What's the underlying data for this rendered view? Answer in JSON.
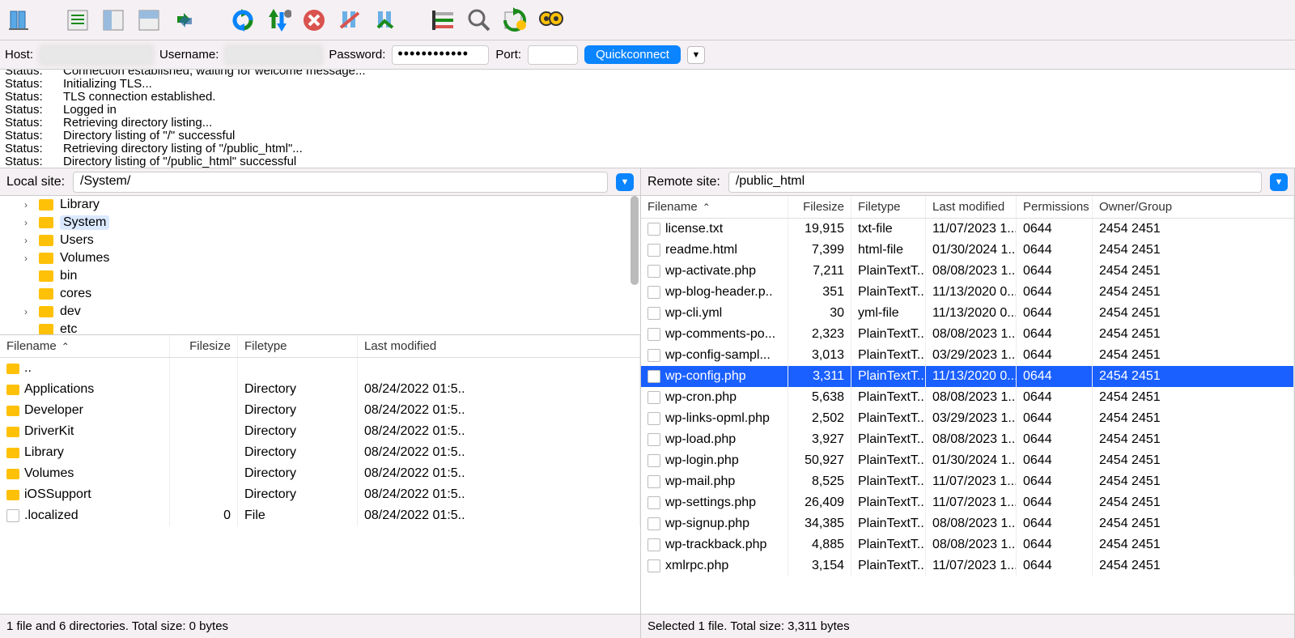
{
  "quickbar": {
    "host_label": "Host:",
    "username_label": "Username:",
    "password_label": "Password:",
    "password_dots": "••••••••••••",
    "port_label": "Port:",
    "quickconnect": "Quickconnect"
  },
  "log": [
    {
      "label": "Status:",
      "msg": "Connection established, waiting for welcome message..."
    },
    {
      "label": "Status:",
      "msg": "Initializing TLS..."
    },
    {
      "label": "Status:",
      "msg": "TLS connection established."
    },
    {
      "label": "Status:",
      "msg": "Logged in"
    },
    {
      "label": "Status:",
      "msg": "Retrieving directory listing..."
    },
    {
      "label": "Status:",
      "msg": "Directory listing of \"/\" successful"
    },
    {
      "label": "Status:",
      "msg": "Retrieving directory listing of \"/public_html\"..."
    },
    {
      "label": "Status:",
      "msg": "Directory listing of \"/public_html\" successful"
    }
  ],
  "local": {
    "site_label": "Local site:",
    "path": "/System/",
    "tree": [
      {
        "name": "Library",
        "expandable": true,
        "selected": false
      },
      {
        "name": "System",
        "expandable": true,
        "selected": true
      },
      {
        "name": "Users",
        "expandable": true,
        "selected": false
      },
      {
        "name": "Volumes",
        "expandable": true,
        "selected": false
      },
      {
        "name": "bin",
        "expandable": false,
        "selected": false
      },
      {
        "name": "cores",
        "expandable": false,
        "selected": false
      },
      {
        "name": "dev",
        "expandable": true,
        "selected": false
      },
      {
        "name": "etc",
        "expandable": false,
        "selected": false
      }
    ],
    "headers": {
      "name": "Filename",
      "size": "Filesize",
      "type": "Filetype",
      "mod": "Last modified"
    },
    "files": [
      {
        "name": "..",
        "size": "",
        "type": "",
        "mod": "",
        "icon": "folder"
      },
      {
        "name": "Applications",
        "size": "",
        "type": "Directory",
        "mod": "08/24/2022 01:5..",
        "icon": "folder"
      },
      {
        "name": "Developer",
        "size": "",
        "type": "Directory",
        "mod": "08/24/2022 01:5..",
        "icon": "folder"
      },
      {
        "name": "DriverKit",
        "size": "",
        "type": "Directory",
        "mod": "08/24/2022 01:5..",
        "icon": "folder"
      },
      {
        "name": "Library",
        "size": "",
        "type": "Directory",
        "mod": "08/24/2022 01:5..",
        "icon": "folder"
      },
      {
        "name": "Volumes",
        "size": "",
        "type": "Directory",
        "mod": "08/24/2022 01:5..",
        "icon": "folder"
      },
      {
        "name": "iOSSupport",
        "size": "",
        "type": "Directory",
        "mod": "08/24/2022 01:5..",
        "icon": "folder"
      },
      {
        "name": ".localized",
        "size": "0",
        "type": "File",
        "mod": "08/24/2022 01:5..",
        "icon": "file"
      }
    ],
    "status": "1 file and 6 directories. Total size: 0 bytes"
  },
  "remote": {
    "site_label": "Remote site:",
    "path": "/public_html",
    "headers": {
      "name": "Filename",
      "size": "Filesize",
      "type": "Filetype",
      "mod": "Last modified",
      "perm": "Permissions",
      "owner": "Owner/Group"
    },
    "files": [
      {
        "name": "license.txt",
        "size": "19,915",
        "type": "txt-file",
        "mod": "11/07/2023 1...",
        "perm": "0644",
        "owner": "2454 2451",
        "selected": false
      },
      {
        "name": "readme.html",
        "size": "7,399",
        "type": "html-file",
        "mod": "01/30/2024 1...",
        "perm": "0644",
        "owner": "2454 2451",
        "selected": false
      },
      {
        "name": "wp-activate.php",
        "size": "7,211",
        "type": "PlainTextT...",
        "mod": "08/08/2023 1...",
        "perm": "0644",
        "owner": "2454 2451",
        "selected": false
      },
      {
        "name": "wp-blog-header.p..",
        "size": "351",
        "type": "PlainTextT...",
        "mod": "11/13/2020 0...",
        "perm": "0644",
        "owner": "2454 2451",
        "selected": false
      },
      {
        "name": "wp-cli.yml",
        "size": "30",
        "type": "yml-file",
        "mod": "11/13/2020 0...",
        "perm": "0644",
        "owner": "2454 2451",
        "selected": false
      },
      {
        "name": "wp-comments-po...",
        "size": "2,323",
        "type": "PlainTextT...",
        "mod": "08/08/2023 1...",
        "perm": "0644",
        "owner": "2454 2451",
        "selected": false
      },
      {
        "name": "wp-config-sampl...",
        "size": "3,013",
        "type": "PlainTextT...",
        "mod": "03/29/2023 1...",
        "perm": "0644",
        "owner": "2454 2451",
        "selected": false
      },
      {
        "name": "wp-config.php",
        "size": "3,311",
        "type": "PlainTextT...",
        "mod": "11/13/2020 0...",
        "perm": "0644",
        "owner": "2454 2451",
        "selected": true
      },
      {
        "name": "wp-cron.php",
        "size": "5,638",
        "type": "PlainTextT...",
        "mod": "08/08/2023 1...",
        "perm": "0644",
        "owner": "2454 2451",
        "selected": false
      },
      {
        "name": "wp-links-opml.php",
        "size": "2,502",
        "type": "PlainTextT...",
        "mod": "03/29/2023 1...",
        "perm": "0644",
        "owner": "2454 2451",
        "selected": false
      },
      {
        "name": "wp-load.php",
        "size": "3,927",
        "type": "PlainTextT...",
        "mod": "08/08/2023 1...",
        "perm": "0644",
        "owner": "2454 2451",
        "selected": false
      },
      {
        "name": "wp-login.php",
        "size": "50,927",
        "type": "PlainTextT...",
        "mod": "01/30/2024 1...",
        "perm": "0644",
        "owner": "2454 2451",
        "selected": false
      },
      {
        "name": "wp-mail.php",
        "size": "8,525",
        "type": "PlainTextT...",
        "mod": "11/07/2023 1...",
        "perm": "0644",
        "owner": "2454 2451",
        "selected": false
      },
      {
        "name": "wp-settings.php",
        "size": "26,409",
        "type": "PlainTextT...",
        "mod": "11/07/2023 1...",
        "perm": "0644",
        "owner": "2454 2451",
        "selected": false
      },
      {
        "name": "wp-signup.php",
        "size": "34,385",
        "type": "PlainTextT...",
        "mod": "08/08/2023 1...",
        "perm": "0644",
        "owner": "2454 2451",
        "selected": false
      },
      {
        "name": "wp-trackback.php",
        "size": "4,885",
        "type": "PlainTextT...",
        "mod": "08/08/2023 1...",
        "perm": "0644",
        "owner": "2454 2451",
        "selected": false
      },
      {
        "name": "xmlrpc.php",
        "size": "3,154",
        "type": "PlainTextT...",
        "mod": "11/07/2023 1...",
        "perm": "0644",
        "owner": "2454 2451",
        "selected": false
      }
    ],
    "status": "Selected 1 file. Total size: 3,311 bytes"
  },
  "toolbar_icons": [
    "site-manager-icon",
    "toggle-log-icon",
    "toggle-local-tree-icon",
    "toggle-remote-tree-icon",
    "toggle-queue-icon",
    "refresh-icon",
    "process-queue-icon",
    "cancel-icon",
    "disconnect-icon",
    "reconnect-icon",
    "filter-icon",
    "search-icon",
    "compare-icon",
    "find-icon"
  ]
}
